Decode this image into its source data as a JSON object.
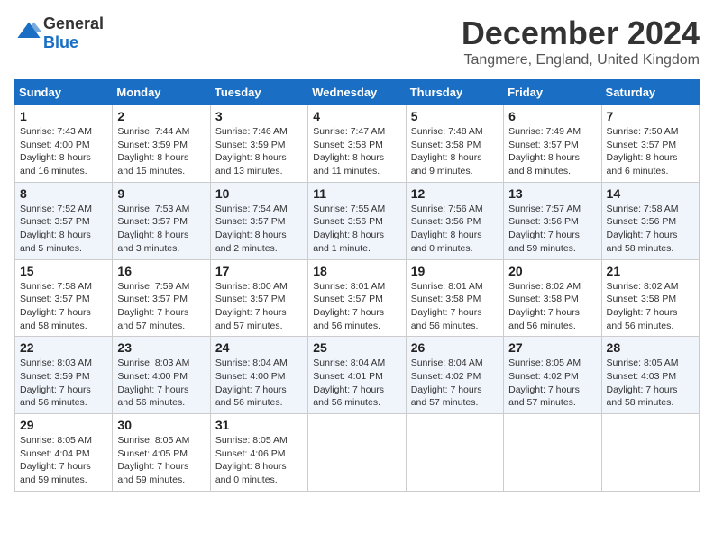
{
  "header": {
    "logo_general": "General",
    "logo_blue": "Blue",
    "month": "December 2024",
    "location": "Tangmere, England, United Kingdom"
  },
  "days_of_week": [
    "Sunday",
    "Monday",
    "Tuesday",
    "Wednesday",
    "Thursday",
    "Friday",
    "Saturday"
  ],
  "weeks": [
    [
      {
        "day": "1",
        "sunrise": "7:43 AM",
        "sunset": "4:00 PM",
        "daylight": "8 hours and 16 minutes."
      },
      {
        "day": "2",
        "sunrise": "7:44 AM",
        "sunset": "3:59 PM",
        "daylight": "8 hours and 15 minutes."
      },
      {
        "day": "3",
        "sunrise": "7:46 AM",
        "sunset": "3:59 PM",
        "daylight": "8 hours and 13 minutes."
      },
      {
        "day": "4",
        "sunrise": "7:47 AM",
        "sunset": "3:58 PM",
        "daylight": "8 hours and 11 minutes."
      },
      {
        "day": "5",
        "sunrise": "7:48 AM",
        "sunset": "3:58 PM",
        "daylight": "8 hours and 9 minutes."
      },
      {
        "day": "6",
        "sunrise": "7:49 AM",
        "sunset": "3:57 PM",
        "daylight": "8 hours and 8 minutes."
      },
      {
        "day": "7",
        "sunrise": "7:50 AM",
        "sunset": "3:57 PM",
        "daylight": "8 hours and 6 minutes."
      }
    ],
    [
      {
        "day": "8",
        "sunrise": "7:52 AM",
        "sunset": "3:57 PM",
        "daylight": "8 hours and 5 minutes."
      },
      {
        "day": "9",
        "sunrise": "7:53 AM",
        "sunset": "3:57 PM",
        "daylight": "8 hours and 3 minutes."
      },
      {
        "day": "10",
        "sunrise": "7:54 AM",
        "sunset": "3:57 PM",
        "daylight": "8 hours and 2 minutes."
      },
      {
        "day": "11",
        "sunrise": "7:55 AM",
        "sunset": "3:56 PM",
        "daylight": "8 hours and 1 minute."
      },
      {
        "day": "12",
        "sunrise": "7:56 AM",
        "sunset": "3:56 PM",
        "daylight": "8 hours and 0 minutes."
      },
      {
        "day": "13",
        "sunrise": "7:57 AM",
        "sunset": "3:56 PM",
        "daylight": "7 hours and 59 minutes."
      },
      {
        "day": "14",
        "sunrise": "7:58 AM",
        "sunset": "3:56 PM",
        "daylight": "7 hours and 58 minutes."
      }
    ],
    [
      {
        "day": "15",
        "sunrise": "7:58 AM",
        "sunset": "3:57 PM",
        "daylight": "7 hours and 58 minutes."
      },
      {
        "day": "16",
        "sunrise": "7:59 AM",
        "sunset": "3:57 PM",
        "daylight": "7 hours and 57 minutes."
      },
      {
        "day": "17",
        "sunrise": "8:00 AM",
        "sunset": "3:57 PM",
        "daylight": "7 hours and 57 minutes."
      },
      {
        "day": "18",
        "sunrise": "8:01 AM",
        "sunset": "3:57 PM",
        "daylight": "7 hours and 56 minutes."
      },
      {
        "day": "19",
        "sunrise": "8:01 AM",
        "sunset": "3:58 PM",
        "daylight": "7 hours and 56 minutes."
      },
      {
        "day": "20",
        "sunrise": "8:02 AM",
        "sunset": "3:58 PM",
        "daylight": "7 hours and 56 minutes."
      },
      {
        "day": "21",
        "sunrise": "8:02 AM",
        "sunset": "3:58 PM",
        "daylight": "7 hours and 56 minutes."
      }
    ],
    [
      {
        "day": "22",
        "sunrise": "8:03 AM",
        "sunset": "3:59 PM",
        "daylight": "7 hours and 56 minutes."
      },
      {
        "day": "23",
        "sunrise": "8:03 AM",
        "sunset": "4:00 PM",
        "daylight": "7 hours and 56 minutes."
      },
      {
        "day": "24",
        "sunrise": "8:04 AM",
        "sunset": "4:00 PM",
        "daylight": "7 hours and 56 minutes."
      },
      {
        "day": "25",
        "sunrise": "8:04 AM",
        "sunset": "4:01 PM",
        "daylight": "7 hours and 56 minutes."
      },
      {
        "day": "26",
        "sunrise": "8:04 AM",
        "sunset": "4:02 PM",
        "daylight": "7 hours and 57 minutes."
      },
      {
        "day": "27",
        "sunrise": "8:05 AM",
        "sunset": "4:02 PM",
        "daylight": "7 hours and 57 minutes."
      },
      {
        "day": "28",
        "sunrise": "8:05 AM",
        "sunset": "4:03 PM",
        "daylight": "7 hours and 58 minutes."
      }
    ],
    [
      {
        "day": "29",
        "sunrise": "8:05 AM",
        "sunset": "4:04 PM",
        "daylight": "7 hours and 59 minutes."
      },
      {
        "day": "30",
        "sunrise": "8:05 AM",
        "sunset": "4:05 PM",
        "daylight": "7 hours and 59 minutes."
      },
      {
        "day": "31",
        "sunrise": "8:05 AM",
        "sunset": "4:06 PM",
        "daylight": "8 hours and 0 minutes."
      },
      null,
      null,
      null,
      null
    ]
  ]
}
